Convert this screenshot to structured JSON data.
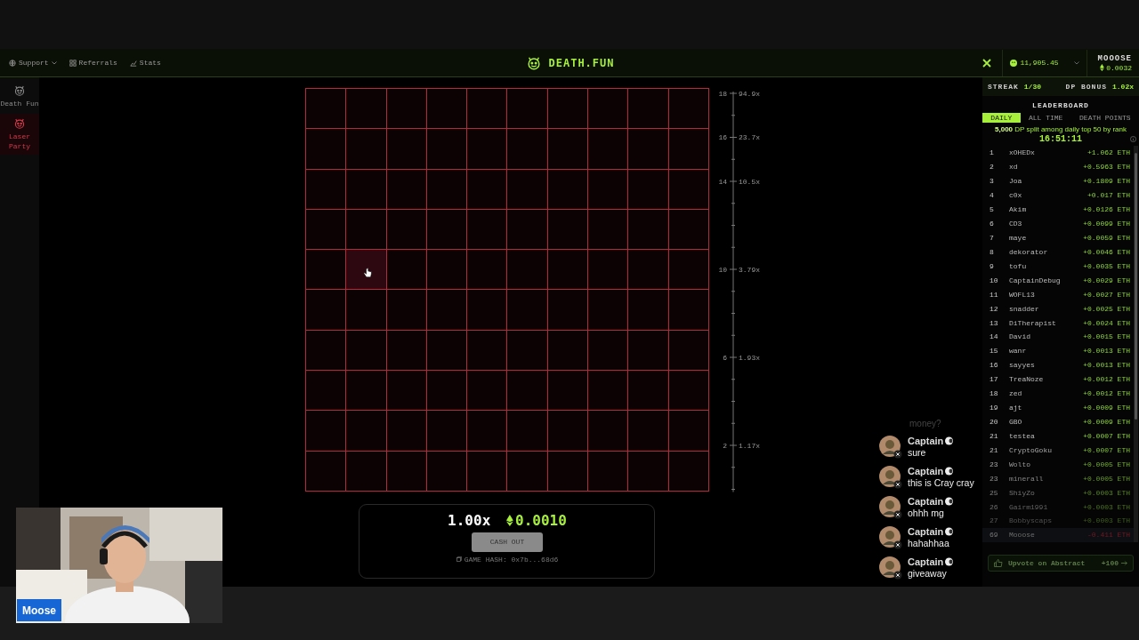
{
  "header": {
    "nav": [
      {
        "label": "Support",
        "kind": "dropdown"
      },
      {
        "label": "Referrals",
        "kind": "link"
      },
      {
        "label": "Stats",
        "kind": "link"
      }
    ],
    "logo": "DEATH.FUN",
    "balance": "11,905.45",
    "user": {
      "name": "MOOOSE",
      "eth": "0.0032"
    }
  },
  "sidebar": [
    {
      "label": "Death Fun",
      "selected": false
    },
    {
      "label": "Laser Party",
      "selected": true
    }
  ],
  "grid": {
    "rows": [
      {
        "highlighted": [
          false,
          false,
          false,
          false,
          false,
          false,
          false,
          false,
          false,
          false
        ]
      },
      {
        "highlighted": [
          false,
          false,
          false,
          false,
          false,
          false,
          false,
          false,
          false,
          false
        ]
      },
      {
        "highlighted": [
          false,
          false,
          false,
          false,
          false,
          false,
          false,
          false,
          false,
          false
        ]
      },
      {
        "highlighted": [
          false,
          false,
          false,
          false,
          false,
          false,
          false,
          false,
          false,
          false
        ]
      },
      {
        "highlighted": [
          false,
          true,
          false,
          false,
          false,
          false,
          false,
          false,
          false,
          false
        ]
      },
      {
        "highlighted": [
          false,
          false,
          false,
          false,
          false,
          false,
          false,
          false,
          false,
          false
        ]
      },
      {
        "highlighted": [
          false,
          false,
          false,
          false,
          false,
          false,
          false,
          false,
          false,
          false
        ]
      },
      {
        "highlighted": [
          false,
          false,
          false,
          false,
          false,
          false,
          false,
          false,
          false,
          false
        ]
      },
      {
        "highlighted": [
          false,
          false,
          false,
          false,
          false,
          false,
          false,
          false,
          false,
          false
        ]
      },
      {
        "highlighted": [
          false,
          false,
          false,
          false,
          false,
          false,
          false,
          false,
          false,
          false
        ]
      }
    ]
  },
  "scale": [
    {
      "kind": "major",
      "value": "18",
      "multiplier": "94.9x"
    },
    {
      "kind": "minor"
    },
    {
      "kind": "major",
      "value": "16",
      "multiplier": "23.7x"
    },
    {
      "kind": "minor"
    },
    {
      "kind": "major",
      "value": "14",
      "multiplier": "10.5x"
    },
    {
      "kind": "minor"
    },
    {
      "kind": "minor"
    },
    {
      "kind": "minor"
    },
    {
      "kind": "major",
      "value": "10",
      "multiplier": "3.79x"
    },
    {
      "kind": "minor"
    },
    {
      "kind": "minor"
    },
    {
      "kind": "minor"
    },
    {
      "kind": "major",
      "value": "6",
      "multiplier": "1.93x"
    },
    {
      "kind": "minor"
    },
    {
      "kind": "minor"
    },
    {
      "kind": "minor"
    },
    {
      "kind": "major",
      "value": "2",
      "multiplier": "1.17x"
    },
    {
      "kind": "minor"
    },
    {
      "kind": "minor"
    }
  ],
  "round": {
    "multiplier": "1.00x",
    "amount": "0.0010",
    "cash_out": {
      "label": "CASH OUT",
      "disabled": true
    },
    "hash": "GAME HASH: 0x7b...68d6"
  },
  "panel": {
    "streak_label": "STREAK",
    "streak": "1/30",
    "bonus_label": "DP BONUS",
    "bonus": "1.02x",
    "title": "LEADERBOARD",
    "tabs": [
      {
        "label": "DAILY",
        "selected": true
      },
      {
        "label": "ALL TIME",
        "selected": false
      },
      {
        "label": "DEATH POINTS",
        "selected": false
      }
    ],
    "note": "**5,000** DP split among daily top 50 by rank",
    "timer": "16:51:11",
    "rows": [
      {
        "rank": "1",
        "name": "xOHEDx",
        "amount": "+1.062 ETH",
        "kind": "player"
      },
      {
        "rank": "2",
        "name": "xd",
        "amount": "+0.5963 ETH",
        "kind": "player"
      },
      {
        "rank": "3",
        "name": "Joa",
        "amount": "+0.1809 ETH",
        "kind": "player"
      },
      {
        "rank": "4",
        "name": "c0x",
        "amount": "+0.017 ETH",
        "kind": "player"
      },
      {
        "rank": "5",
        "name": "Akim",
        "amount": "+0.0126 ETH",
        "kind": "player"
      },
      {
        "rank": "6",
        "name": "CD3",
        "amount": "+0.0099 ETH",
        "kind": "player"
      },
      {
        "rank": "7",
        "name": "maye",
        "amount": "+0.0059 ETH",
        "kind": "player"
      },
      {
        "rank": "8",
        "name": "dekorator",
        "amount": "+0.0046 ETH",
        "kind": "player"
      },
      {
        "rank": "9",
        "name": "tofu",
        "amount": "+0.0035 ETH",
        "kind": "player"
      },
      {
        "rank": "10",
        "name": "CaptainDebug",
        "amount": "+0.0029 ETH",
        "kind": "player"
      },
      {
        "rank": "11",
        "name": "WOFL13",
        "amount": "+0.0027 ETH",
        "kind": "player"
      },
      {
        "rank": "12",
        "name": "snadder",
        "amount": "+0.0025 ETH",
        "kind": "player"
      },
      {
        "rank": "13",
        "name": "DiTherapist",
        "amount": "+0.0024 ETH",
        "kind": "player"
      },
      {
        "rank": "14",
        "name": "David",
        "amount": "+0.0015 ETH",
        "kind": "player"
      },
      {
        "rank": "15",
        "name": "wanr",
        "amount": "+0.0013 ETH",
        "kind": "player"
      },
      {
        "rank": "16",
        "name": "sayyes",
        "amount": "+0.0013 ETH",
        "kind": "player"
      },
      {
        "rank": "17",
        "name": "TreaNoze",
        "amount": "+0.0012 ETH",
        "kind": "player"
      },
      {
        "rank": "18",
        "name": "zed",
        "amount": "+0.0012 ETH",
        "kind": "player"
      },
      {
        "rank": "19",
        "name": "ajt",
        "amount": "+0.0009 ETH",
        "kind": "player"
      },
      {
        "rank": "20",
        "name": "GBO",
        "amount": "+0.0009 ETH",
        "kind": "player"
      },
      {
        "rank": "21",
        "name": "testea",
        "amount": "+0.0007 ETH",
        "kind": "player"
      },
      {
        "rank": "21",
        "name": "CryptoGoku",
        "amount": "+0.0007 ETH",
        "kind": "player"
      },
      {
        "rank": "23",
        "name": "Wolto",
        "amount": "+0.0005 ETH",
        "kind": "player"
      },
      {
        "rank": "23",
        "name": "minerall",
        "amount": "+0.0005 ETH",
        "kind": "player"
      },
      {
        "rank": "25",
        "name": "ShiyZo",
        "amount": "+0.0003 ETH",
        "kind": "player"
      },
      {
        "rank": "26",
        "name": "Gairm1991",
        "amount": "+0.0003 ETH",
        "kind": "player"
      },
      {
        "rank": "27",
        "name": "Bobbyscaps",
        "amount": "+0.0003 ETH",
        "kind": "player"
      },
      {
        "rank": "69",
        "name": "Mooose",
        "amount": "-0.411 ETH",
        "kind": "self"
      }
    ],
    "upvote": {
      "label": "Upvote on Abstract",
      "reward": "+100"
    }
  },
  "webcam": {
    "name": "Moose"
  },
  "chat": {
    "faded": "money?",
    "messages": [
      {
        "author": "Captain",
        "text": "sure"
      },
      {
        "author": "Captain",
        "text": "this is Cray cray"
      },
      {
        "author": "Captain",
        "text": "ohhh mg"
      },
      {
        "author": "Captain",
        "text": "hahahhaa"
      },
      {
        "author": "Captain",
        "text": "giveaway"
      }
    ]
  }
}
